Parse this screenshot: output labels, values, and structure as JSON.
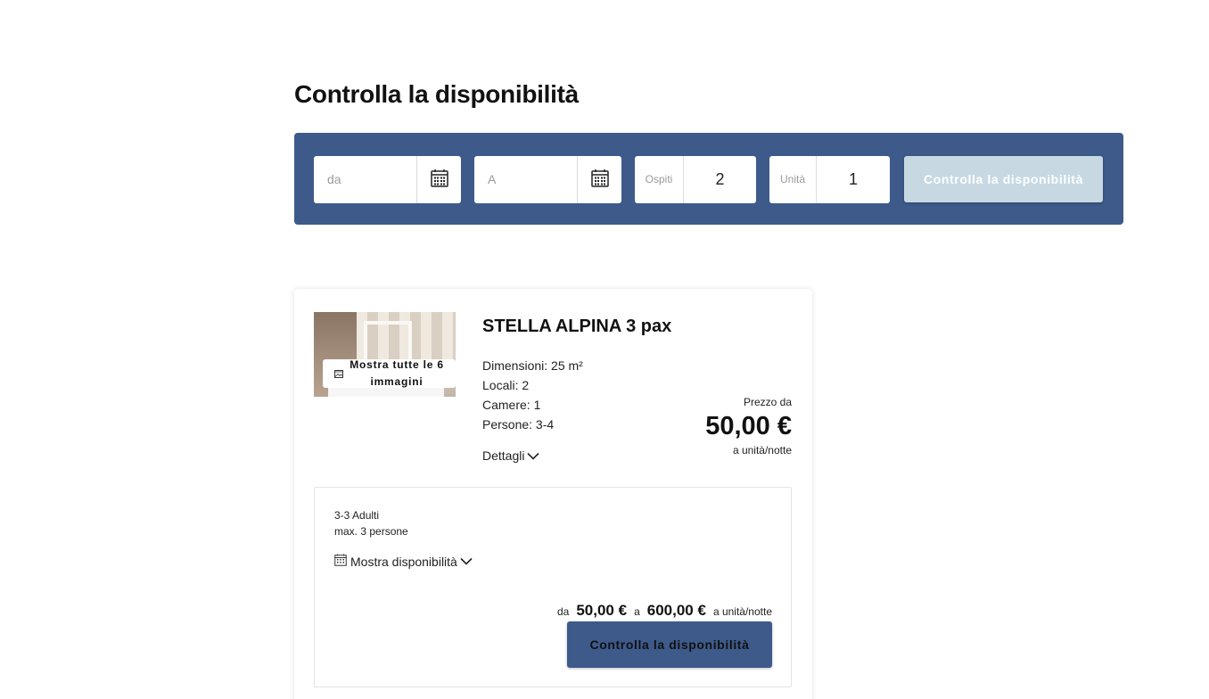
{
  "page": {
    "title": "Controlla la disponibilità"
  },
  "search": {
    "date_from_placeholder": "da",
    "date_to_placeholder": "A",
    "guests_label": "Ospiti",
    "guests_value": "2",
    "units_label": "Unità",
    "units_value": "1",
    "button_label": "Controlla la disponibilità"
  },
  "room": {
    "name": "STELLA ALPINA 3 pax",
    "gallery_button": "Mostra tutte le 6 immagini",
    "info": [
      "Dimensioni: 25 m²",
      "Locali: 2",
      "Camere: 1",
      "Persone: 3-4"
    ],
    "details_label": "Dettagli",
    "price_label": "Prezzo da",
    "price_value": "50,00 €",
    "price_unit": "a unità/notte"
  },
  "rate": {
    "adults": "3-3 Adulti",
    "max_persons": "max. 3 persone",
    "availability_label": "Mostra disponibilità",
    "from_label": "da",
    "price_from": "50,00 €",
    "to_label": "a",
    "price_to": "600,00 €",
    "unit": "a unità/notte",
    "button_label": "Controlla la disponibilità"
  },
  "colors": {
    "primary": "#3d5a8a",
    "disabled_button": "#c7d8e2",
    "text": "#111111"
  },
  "icons": {
    "date_picker": "calendar-icon",
    "gallery": "image-icon",
    "expand": "chevron-down-icon"
  }
}
